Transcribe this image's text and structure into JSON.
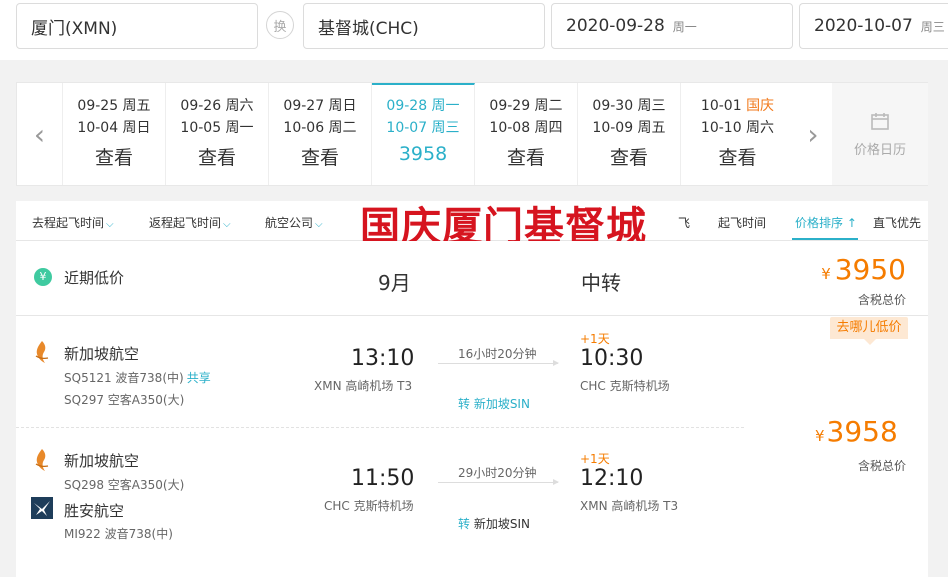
{
  "search": {
    "from": "厦门(XMN)",
    "swap_label": "换",
    "to": "基督城(CHC)",
    "depart_date": "2020-09-28",
    "depart_dow": "周一",
    "return_date": "2020-10-07",
    "return_dow": "周三"
  },
  "date_strip": {
    "cells": [
      {
        "out": "09-25 周五",
        "back": "10-04 周日",
        "price": "查看"
      },
      {
        "out": "09-26 周六",
        "back": "10-05 周一",
        "price": "查看"
      },
      {
        "out": "09-27 周日",
        "back": "10-06 周二",
        "price": "查看"
      },
      {
        "out": "09-28 周一",
        "back": "10-07 周三",
        "price": "3958"
      },
      {
        "out": "09-29 周二",
        "back": "10-08 周四",
        "price": "查看"
      },
      {
        "out": "09-30 周三",
        "back": "10-09 周五",
        "price": "查看"
      },
      {
        "out_date": "10-01",
        "out_dow": "国庆",
        "back": "10-10 周六",
        "price": "查看"
      }
    ],
    "calendar_label": "价格日历"
  },
  "filters": {
    "depart_time": "去程起飞时间",
    "return_time": "返程起飞时间",
    "airline": "航空公司",
    "takeoff": "起飞时间",
    "price_sort": "价格排序",
    "price_sort_arrow": "↑",
    "direct_first": "直飞优先",
    "tail_fragment": "飞",
    "stamp": "国庆厦门基督城"
  },
  "low_price": {
    "badge": "¥",
    "label": "近期低价",
    "month": "9月",
    "transfer": "中转",
    "currency": "¥",
    "price": "3950",
    "tax_note": "含税总价",
    "qunar_tag": "去哪儿低价"
  },
  "outbound": {
    "airline": "新加坡航空",
    "flight1": "SQ5121 波音738(中)",
    "share": "共享",
    "flight2": "SQ297 空客A350(大)",
    "dep_time": "13:10",
    "dep_airport": "XMN 高崎机场 T3",
    "duration": "16小时20分钟",
    "via": "转 新加坡SIN",
    "plus_day": "+1天",
    "arr_time": "10:30",
    "arr_airport": "CHC 克斯特机场"
  },
  "inbound": {
    "airline": "新加坡航空",
    "flight1": "SQ298 空客A350(大)",
    "airline2": "胜安航空",
    "flight2": "MI922 波音738(中)",
    "dep_time": "11:50",
    "dep_airport": "CHC 克斯特机场",
    "duration": "29小时20分钟",
    "via_prefix": "转",
    "via_city": "新加坡SIN",
    "plus_day": "+1天",
    "arr_time": "12:10",
    "arr_airport": "XMN 高崎机场 T3",
    "currency": "¥",
    "price": "3958",
    "tax_note": "含税总价"
  },
  "colors": {
    "accent": "#2bb0c9",
    "price": "#f57c00",
    "stamp": "#d6141f",
    "holiday": "#f27a1d"
  }
}
